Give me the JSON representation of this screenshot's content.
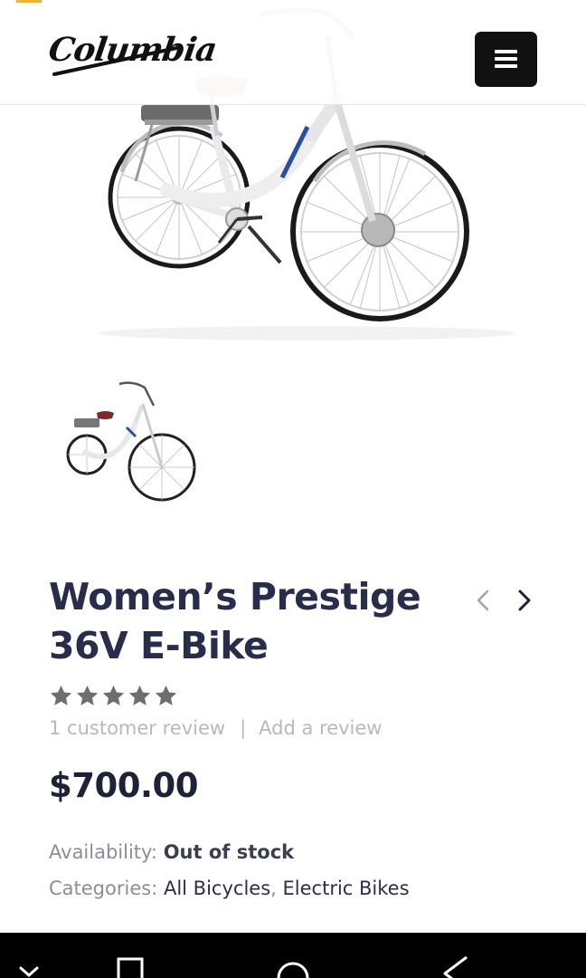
{
  "header": {
    "logo_text": "Columbia",
    "menu_icon": "hamburger-menu-icon",
    "accent_color": "#e8b53a"
  },
  "gallery": {
    "main_image": "womens-prestige-ebike-white",
    "thumbnail": "womens-prestige-ebike-white-thumb",
    "bike_brand_decal": "COLUMBIA"
  },
  "product": {
    "title": "Women’s Prestige 36V E-Bike",
    "title_line1": "Women’s Prestige",
    "title_line2": "36V E-Bike",
    "rating": 5,
    "rating_max": 5,
    "review_count_text": "1 customer review",
    "review_separator": "|",
    "add_review_label": "Add a review",
    "price_currency": "$",
    "price_amount": "700.00",
    "availability_label": "Availability:",
    "availability_value": "Out of stock",
    "categories_label": "Categories:",
    "categories": [
      "All Bicycles",
      "Electric Bikes"
    ],
    "categories_comma": ",",
    "prev_icon": "chevron-left-icon",
    "next_icon": "chevron-right-icon"
  },
  "system_nav": {
    "icons": [
      "chevron-down-icon",
      "square-recents-icon",
      "circle-home-icon",
      "triangle-back-icon"
    ]
  },
  "colors": {
    "title": "#272d4a",
    "price": "#1e2238",
    "muted": "#b8b8be",
    "star": "#6e6e6e",
    "decal_blue": "#2a4fa0"
  }
}
